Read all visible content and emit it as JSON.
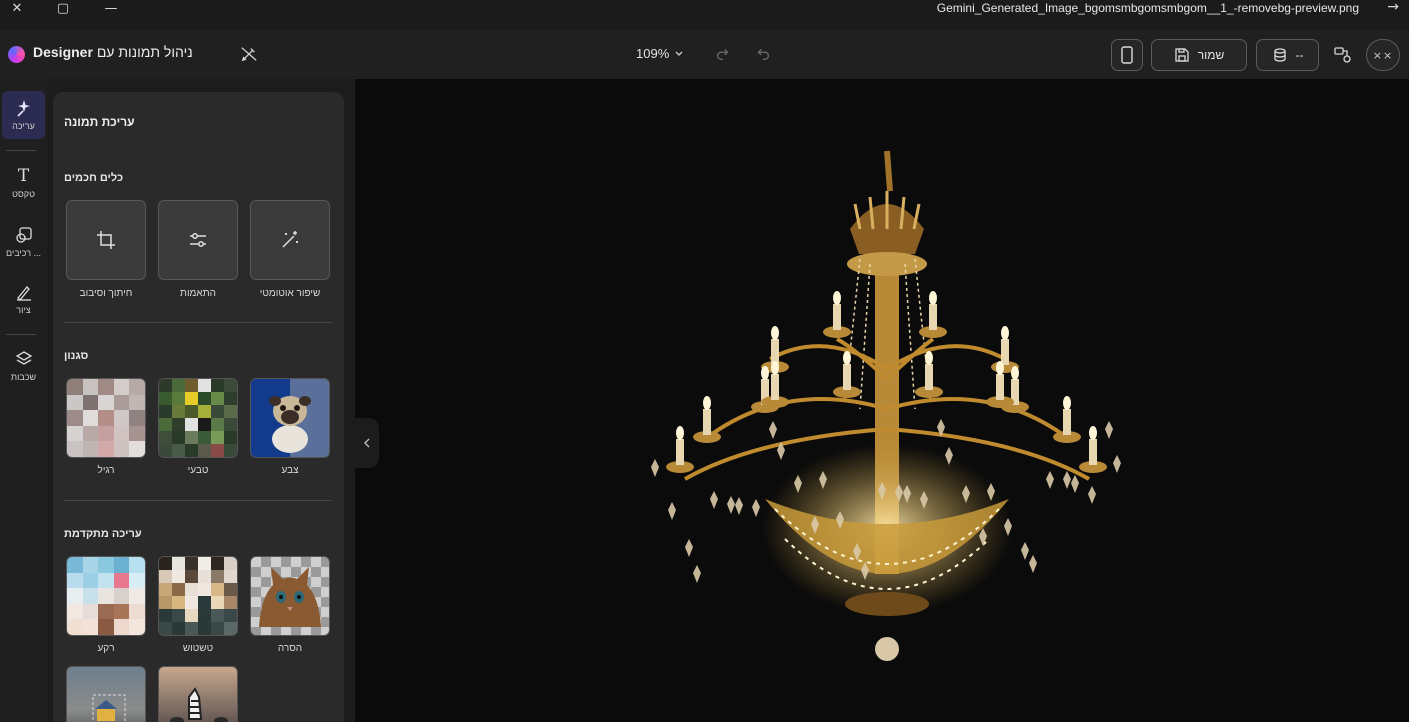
{
  "window": {
    "file_title": "Gemini_Generated_Image_bgomsmbgomsmbgom__1_-removebg-preview.png",
    "controls": [
      "close-icon",
      "maximize-icon",
      "minimize-icon"
    ],
    "back_icon": "arrow-right-icon"
  },
  "header": {
    "brand_bold": "Designer",
    "brand_rest": "ניהול תמונות עם",
    "zoom_label": "109%",
    "save_label": "שמור",
    "credits_label": "--",
    "close_label": "××",
    "icons": [
      "brush-off-icon",
      "chevron-down-icon",
      "redo-icon",
      "undo-icon",
      "phone-icon",
      "save-icon",
      "coins-icon",
      "layout-icon"
    ]
  },
  "rail": {
    "items": [
      {
        "label": "עריכה",
        "icon": "sparkle-wand-icon",
        "active": true
      },
      {
        "label": "טקסט",
        "icon": "text-icon",
        "active": false
      },
      {
        "label": "רכיבים ...",
        "icon": "elements-icon",
        "active": false
      },
      {
        "label": "ציור",
        "icon": "draw-icon",
        "active": false
      },
      {
        "label": "שכבות",
        "icon": "layers-icon",
        "active": false
      }
    ]
  },
  "panel": {
    "title": "עריכת תמונה",
    "quick_tools": {
      "title": "כלים חכמים",
      "items": [
        {
          "label": "חיתוך וסיבוב",
          "icon": "crop-icon"
        },
        {
          "label": "התאמות",
          "icon": "sliders-icon"
        },
        {
          "label": "שיפור אוטומטי",
          "icon": "magic-wand-icon"
        }
      ]
    },
    "filters": {
      "title": "סגנון",
      "items": [
        {
          "label": "רגיל"
        },
        {
          "label": "טבעי"
        },
        {
          "label": "צבע"
        }
      ]
    },
    "effects": {
      "title": "עריכה מתקדמת",
      "items": [
        {
          "label": "רקע"
        },
        {
          "label": "טשטוש"
        },
        {
          "label": "הסרה"
        },
        {
          "label": ""
        },
        {
          "label": ""
        }
      ]
    }
  },
  "canvas": {
    "image_subject": "chandelier",
    "background": "#0b0b0b"
  },
  "colors": {
    "accent": "#2c2c52",
    "gold": "#c89a3a"
  }
}
